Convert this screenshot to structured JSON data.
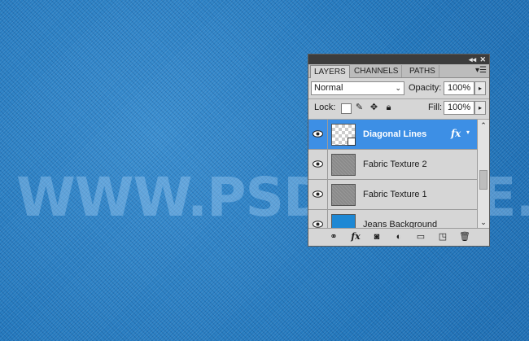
{
  "canvas": {
    "watermark_text": "WWW.PSD-DUDE.COM",
    "fabric_color": "#2a7fc4"
  },
  "panel": {
    "titlebar": {
      "collapse_icon": "double-arrow-icon",
      "close_icon": "close-icon"
    },
    "tabs": [
      {
        "label": "LAYERS",
        "active": true
      },
      {
        "label": "CHANNELS",
        "active": false
      },
      {
        "label": "PATHS",
        "active": false
      }
    ],
    "blend_mode": "Normal",
    "opacity_label": "Opacity:",
    "opacity_value": "100%",
    "lock_label": "Lock:",
    "fill_label": "Fill:",
    "fill_value": "100%",
    "layers": [
      {
        "name": "Diagonal Lines",
        "selected": true,
        "has_fx": true,
        "fx_label": "fx",
        "thumb": "checker"
      },
      {
        "name": "Fabric Texture 2",
        "selected": false,
        "has_fx": false,
        "thumb": "fabric"
      },
      {
        "name": "Fabric Texture 1",
        "selected": false,
        "has_fx": false,
        "thumb": "fabric"
      },
      {
        "name": "Jeans Background",
        "selected": false,
        "has_fx": false,
        "thumb": "jeans"
      }
    ],
    "bottom_tools": [
      "link-icon",
      "fx-icon",
      "mask-icon",
      "adjustment-icon",
      "folder-icon",
      "new-layer-icon",
      "trash-icon"
    ],
    "bottom_fx_label": "fx",
    "accent_color": "#3d8fe5"
  }
}
